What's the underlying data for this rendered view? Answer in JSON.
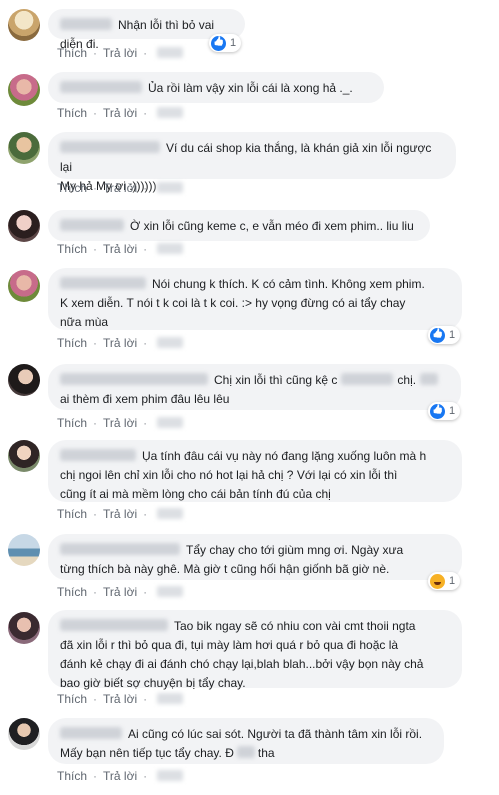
{
  "labels": {
    "like": "Thích",
    "reply": "Trả lời"
  },
  "comments": [
    {
      "text": "Nhận lỗi thì bỏ vai diễn đi.",
      "reaction": {
        "type": "like",
        "count": "1"
      }
    },
    {
      "text": "Ủa rồi làm vậy xin lỗi cái là xong hả ._."
    },
    {
      "text_line1": "Ví du cái shop kia thắng, là khán giả xin lỗi ngược lại",
      "text_line2": "My hả My ơi :))))))"
    },
    {
      "text": "Ờ xin lỗi cũng keme c, e vẫn méo đi xem phim.. liu liu"
    },
    {
      "text_line1": "Nói chung k thích. K có cảm tình. Không xem phim.",
      "text_line2": "K xem diễn. T nói t k coi là t k coi. :> hy vọng đừng có ai tẩy chay",
      "text_line3": "nữa mùa",
      "reaction": {
        "type": "like",
        "count": "1"
      }
    },
    {
      "text_a": "Chị xin lỗi thì cũng kệ c",
      "text_b": "chị.",
      "text_line2": "ai thèm đi xem phim đâu lêu lêu",
      "reaction": {
        "type": "like",
        "count": "1"
      }
    },
    {
      "text_line1": "Ụa tính đâu cái vụ này nó đang lặng xuống luôn mà h",
      "text_line2": "chị ngoi lên chỉ xin lỗi cho nó hot lại hả chị ? Với lại có xin lỗi thì",
      "text_line3": "cũng ít ai mà mềm lòng cho cái bản tính đú của chị"
    },
    {
      "text_line1": "Tẩy chay cho tới giùm mng ơi. Ngày xưa",
      "text_line2": "từng thích bà này ghê. Mà giờ t cũng hối hận giốnh bã giờ nè.",
      "reaction": {
        "type": "haha",
        "count": "1"
      }
    },
    {
      "text_line1": "Tao bik ngay sẽ có nhiu con vài cmt thoii ngta",
      "text_line2": "đã xin lỗi r thì bỏ qua đi, tụi mày làm hơi quá r bỏ qua đi hoặc là",
      "text_line3": "đánh kẻ chạy đi ai đánh chó chạy lại,blah blah...bởi vậy bọn này chả",
      "text_line4": "bao giờ biết sợ chuyện bị tẩy chay."
    },
    {
      "text_line1": "Ai cũng có lúc sai sót. Người ta đã thành tâm xin lỗi rồi.",
      "text_a": "Mấy bạn nên tiếp tục tẩy chay. Đ",
      "text_b": "tha"
    }
  ],
  "colors": {
    "bubble": "#f2f3f5",
    "action_text": "#606770",
    "like_blue": "#1877f2",
    "haha_yellow": "#f7b125"
  }
}
